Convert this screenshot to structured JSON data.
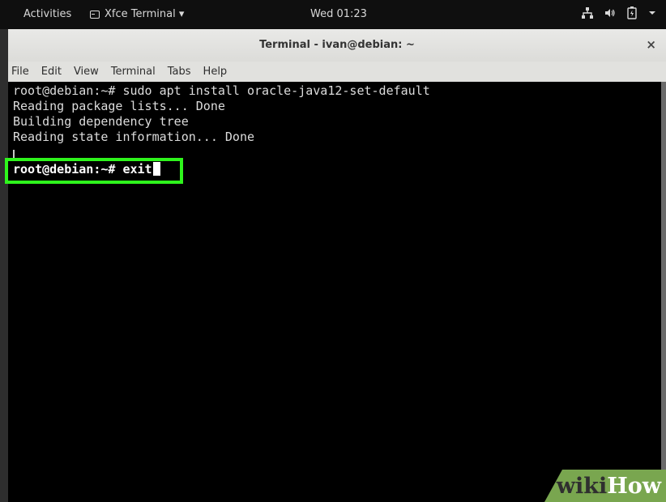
{
  "topbar": {
    "activities": "Activities",
    "app_menu": "Xfce Terminal ▾",
    "clock": "Wed 01:23",
    "icons": [
      "network-icon",
      "volume-icon",
      "battery-icon",
      "chevron-down-icon"
    ]
  },
  "window": {
    "title": "Terminal - ivan@debian: ~",
    "close": "×"
  },
  "menubar": {
    "items": [
      "File",
      "Edit",
      "View",
      "Terminal",
      "Tabs",
      "Help"
    ]
  },
  "terminal": {
    "lines": [
      "root@debian:~# sudo apt install oracle-java12-set-default",
      "Reading package lists... Done",
      "Building dependency tree",
      "Reading state information... Done"
    ],
    "highlighted_command": "root@debian:~# exit"
  },
  "watermark": {
    "part1": "wiki",
    "part2": "How"
  },
  "colors": {
    "highlight": "#2ef51c",
    "watermark_bg": "#79a64f"
  }
}
